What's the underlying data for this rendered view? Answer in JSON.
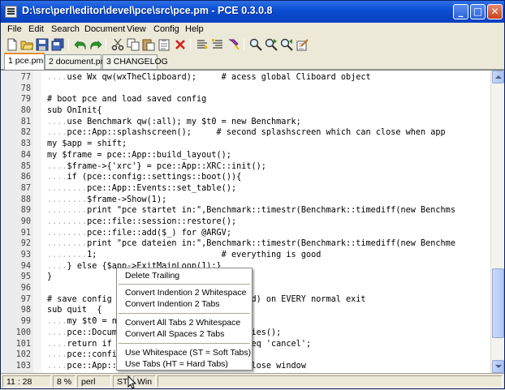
{
  "window": {
    "title": "D:\\src\\perl\\editor\\devel\\pce\\src\\pce.pm - PCE 0.3.0.8",
    "buttons": {
      "minimize": "_",
      "maximize": "□",
      "close": "✕"
    }
  },
  "menu": [
    "File",
    "Edit",
    "Search",
    "Document",
    "View",
    "Config",
    "Help"
  ],
  "toolbar": {
    "icons": [
      "new-file-icon",
      "open-file-icon",
      "save-icon",
      "save-all-icon",
      "undo-icon",
      "redo-icon",
      "cut-icon",
      "copy-icon",
      "paste-icon",
      "clipboard-icon",
      "delete-icon",
      "comment-icon",
      "uncomment-icon",
      "brush-icon",
      "find-icon",
      "find-next-icon",
      "find-prev-icon",
      "replace-icon"
    ]
  },
  "tabs": [
    {
      "label": "1 pce.pm",
      "active": true
    },
    {
      "label": "2 document.pm",
      "active": false
    },
    {
      "label": "3 CHANGELOG",
      "active": false
    }
  ],
  "editor": {
    "lines": [
      {
        "num": "77",
        "dots": "....",
        "code": "use Wx qw(wxTheClipboard);     # acess global Cliboard object"
      },
      {
        "num": "78",
        "dots": "",
        "code": ""
      },
      {
        "num": "79",
        "dots": "",
        "code": "# boot pce and load saved config"
      },
      {
        "num": "80",
        "dots": "",
        "code": "sub OnInit{"
      },
      {
        "num": "81",
        "dots": "....",
        "code": "use Benchmark qw(:all); my $t0 = new Benchmark;"
      },
      {
        "num": "82",
        "dots": "....",
        "code": "pce::App::splashscreen();     # second splashscreen which can close when app"
      },
      {
        "num": "83",
        "dots": "",
        "code": "my $app = shift;"
      },
      {
        "num": "84",
        "dots": "",
        "code": "my $frame = pce::App::build_layout();"
      },
      {
        "num": "85",
        "dots": "....",
        "code": "$frame->{'xrc'} = pce::App::XRC::init();"
      },
      {
        "num": "86",
        "dots": "....",
        "code": "if (pce::config::settings::boot()){"
      },
      {
        "num": "87",
        "dots": "........",
        "code": "pce::App::Events::set_table();"
      },
      {
        "num": "88",
        "dots": "........",
        "code": "$frame->Show(1);"
      },
      {
        "num": "89",
        "dots": "........",
        "code": "print \"pce startet in:\",Benchmark::timestr(Benchmark::timediff(new Benchms"
      },
      {
        "num": "90",
        "dots": "........",
        "code": "pce::file::session::restore();"
      },
      {
        "num": "91",
        "dots": "........",
        "code": "pce::file::add($_) for @ARGV;"
      },
      {
        "num": "92",
        "dots": "........",
        "code": "print \"pce dateien in:\",Benchmark::timestr(Benchmark::timediff(new Benchme"
      },
      {
        "num": "93",
        "dots": "........",
        "code": "1;                         # everything is good"
      },
      {
        "num": "94",
        "dots": "....",
        "code": "} else {$app->ExitMainLoop(1);}"
      },
      {
        "num": "95",
        "dots": "",
        "code": "}"
      },
      {
        "num": "96",
        "dots": "",
        "code": ""
      },
      {
        "num": "97",
        "dots": "",
        "code": "# save config                   (if wanted) on EVERY normal exit"
      },
      {
        "num": "98",
        "dots": "",
        "code": "sub quit  {"
      },
      {
        "num": "99",
        "dots": "....",
        "code": "my $t0 = n"
      },
      {
        "num": "100",
        "dots": "....",
        "code": "pce::Docum                        erties();"
      },
      {
        "num": "101",
        "dots": "....",
        "code": "return if                         () eq 'cancel';"
      },
      {
        "num": "102",
        "dots": "....",
        "code": "pce::confi"
      },
      {
        "num": "103",
        "dots": "....",
        "code": "pce::App::                        # close window"
      }
    ]
  },
  "context_menu": {
    "groups": [
      [
        "Delete Trailing"
      ],
      [
        "Convert Indention 2 Whitespace",
        "Convert Indention 2 Tabs"
      ],
      [
        "Convert All Tabs 2 Whitespace",
        "Convert All Spaces 2 Tabs"
      ],
      [
        "Use Whitespace (ST = Soft Tabs)",
        "Use Tabs (HT = Hard Tabs)"
      ]
    ]
  },
  "status": {
    "position": "11 : 28",
    "percent": "8 %",
    "language": "perl",
    "tab_mode": "ST",
    "line_ending": "Win"
  }
}
